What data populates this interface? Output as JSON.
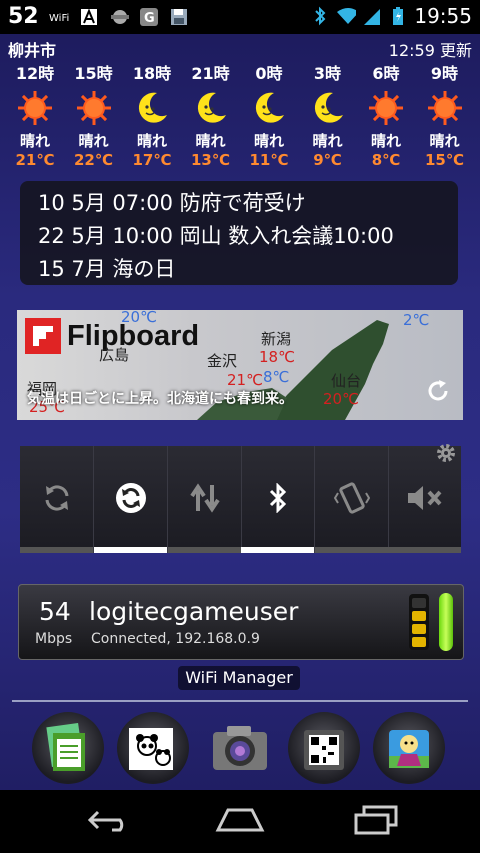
{
  "status_bar": {
    "notification_number": "52",
    "time": "19:55",
    "icons": [
      "wifi-tag-icon",
      "a-icon",
      "robot-icon",
      "g-icon",
      "save-icon",
      "bluetooth-icon",
      "wifi-signal-icon",
      "cell-signal-icon",
      "battery-icon"
    ]
  },
  "weather": {
    "city": "柳井市",
    "updated": "12:59 更新",
    "forecast": [
      {
        "hour": "12時",
        "icon": "sun-icon",
        "condition": "晴れ",
        "temp": "21℃"
      },
      {
        "hour": "15時",
        "icon": "sun-icon",
        "condition": "晴れ",
        "temp": "22℃"
      },
      {
        "hour": "18時",
        "icon": "moon-icon",
        "condition": "晴れ",
        "temp": "17℃"
      },
      {
        "hour": "21時",
        "icon": "moon-icon",
        "condition": "晴れ",
        "temp": "13℃"
      },
      {
        "hour": "0時",
        "icon": "moon-icon",
        "condition": "晴れ",
        "temp": "11℃"
      },
      {
        "hour": "3時",
        "icon": "moon-icon",
        "condition": "晴れ",
        "temp": "9℃"
      },
      {
        "hour": "6時",
        "icon": "sun-icon",
        "condition": "晴れ",
        "temp": "8℃"
      },
      {
        "hour": "9時",
        "icon": "sun-icon",
        "condition": "晴れ",
        "temp": "15℃"
      }
    ]
  },
  "calendar": {
    "events": [
      "10 5月 07:00 防府で荷受け",
      "22 5月 10:00 岡山  数入れ会議10:00",
      "15 7月 海の日"
    ]
  },
  "flipboard": {
    "brand": "Flipboard",
    "caption": "気温は日ごとに上昇。北海道にも春到来。",
    "map_labels": [
      {
        "text": "20℃",
        "color": "#3a6fd8"
      },
      {
        "text": "新潟",
        "color": "#222222"
      },
      {
        "text": "2℃",
        "color": "#3a6fd8"
      },
      {
        "text": "金沢",
        "color": "#222222"
      },
      {
        "text": "18℃",
        "color": "#d42020"
      },
      {
        "text": "広島",
        "color": "#222222"
      },
      {
        "text": "21℃",
        "color": "#d42020"
      },
      {
        "text": "8℃",
        "color": "#3a6fd8"
      },
      {
        "text": "仙台",
        "color": "#222222"
      },
      {
        "text": "福岡",
        "color": "#222222"
      },
      {
        "text": "20℃",
        "color": "#d42020"
      },
      {
        "text": "25℃",
        "color": "#d42020"
      }
    ]
  },
  "toggles": [
    {
      "name": "sync",
      "icon": "sync-icon",
      "active": false
    },
    {
      "name": "auto-rotate",
      "icon": "rotate-icon",
      "active": true
    },
    {
      "name": "data",
      "icon": "data-arrows-icon",
      "active": false
    },
    {
      "name": "bluetooth",
      "icon": "bluetooth-icon",
      "active": true
    },
    {
      "name": "vibrate",
      "icon": "vibrate-icon",
      "active": false
    },
    {
      "name": "mute",
      "icon": "mute-icon",
      "active": false
    }
  ],
  "wifi_widget": {
    "speed": "54",
    "unit": "Mbps",
    "ssid": "logitecgameuser",
    "status": "Connected, 192.168.0.9",
    "signal_level": 0.75
  },
  "wifi_manager_label": "WiFi Manager",
  "dock": [
    "notes-folder-icon",
    "panda-folder-icon",
    "camera-icon",
    "qr-folder-icon",
    "character-folder-icon"
  ],
  "navbar": [
    "back-icon",
    "home-icon",
    "recent-apps-icon"
  ]
}
